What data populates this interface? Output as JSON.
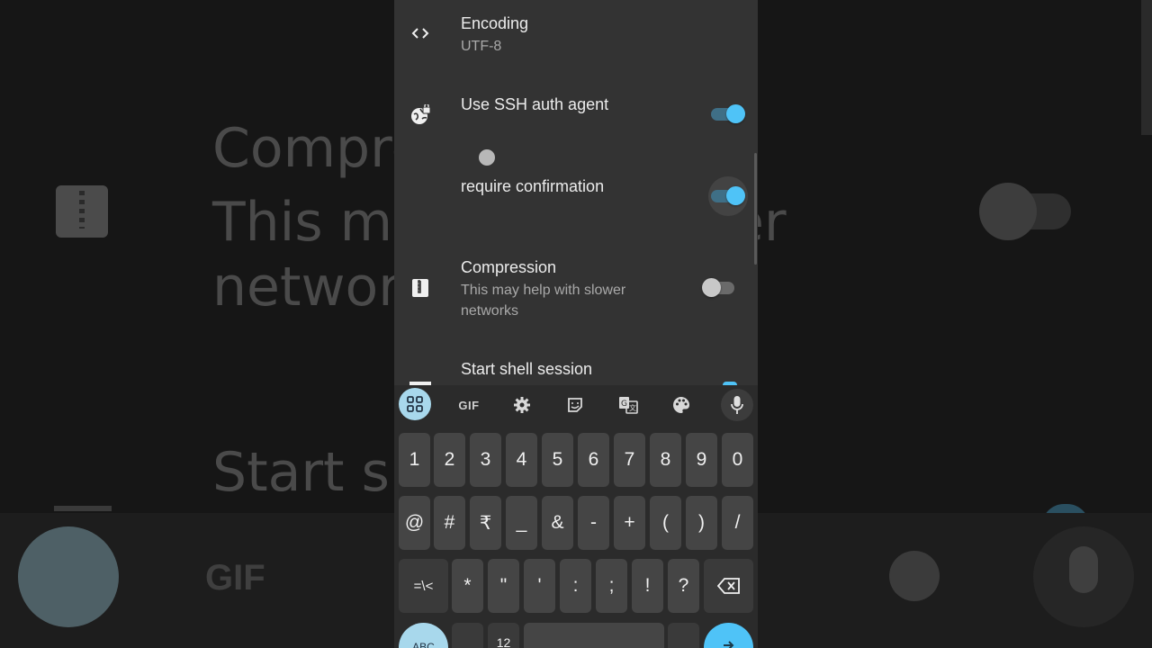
{
  "background": {
    "compress_title": "Compre",
    "compress_sub_line1": "This may",
    "compress_sub_line2": "network",
    "compress_sub_tail": "er",
    "start_title": "Start sh",
    "gif": "GIF"
  },
  "settings": {
    "encoding": {
      "title": "Encoding",
      "value": "UTF-8",
      "icon": "code-icon"
    },
    "ssh_agent": {
      "title": "Use SSH auth agent",
      "enabled": true,
      "icon": "globe-lock-icon"
    },
    "require_confirmation": {
      "title": "require confirmation",
      "enabled": true
    },
    "compression": {
      "title": "Compression",
      "subtitle_line1": "This may help with slower",
      "subtitle_line2": "networks",
      "enabled": false,
      "icon": "zip-icon"
    },
    "start_shell": {
      "title": "Start shell session",
      "enabled": true
    }
  },
  "keyboard": {
    "toolbar": {
      "gif": "GIF",
      "icons": [
        "apps-grid-icon",
        "gif-icon",
        "gear-icon",
        "sticker-icon",
        "translate-icon",
        "palette-icon",
        "mic-icon"
      ]
    },
    "row1": [
      "1",
      "2",
      "3",
      "4",
      "5",
      "6",
      "7",
      "8",
      "9",
      "0"
    ],
    "row2": [
      "@",
      "#",
      "₹",
      "_",
      "&",
      "-",
      "+",
      "(",
      ")",
      "/"
    ],
    "row3": [
      "=\\<",
      "*",
      "\"",
      "'",
      ":",
      ";",
      "!",
      "?"
    ],
    "row4": [
      "ABC",
      "12"
    ],
    "accent_color": "#4fc3f7"
  }
}
